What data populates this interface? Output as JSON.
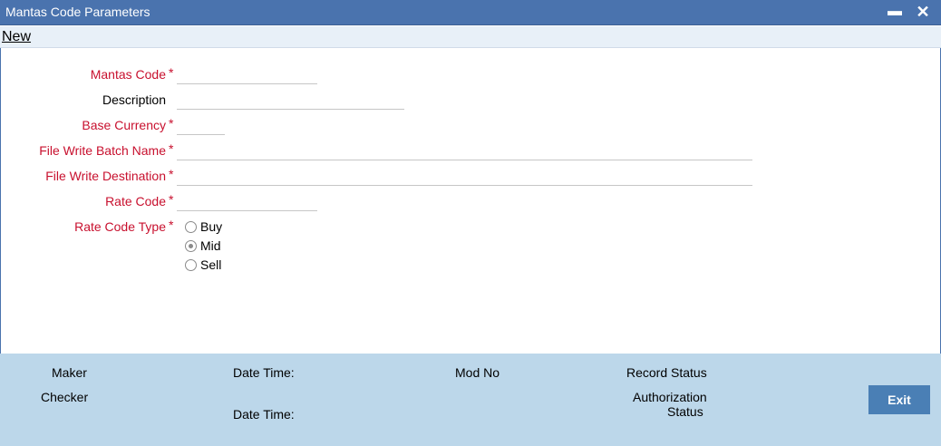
{
  "window": {
    "title": "Mantas Code Parameters",
    "minimize_symbol": "▬",
    "close_symbol": "✕"
  },
  "toolbar": {
    "new_label": "New"
  },
  "form": {
    "mantas_code": {
      "label": "Mantas Code",
      "required": "*",
      "value": ""
    },
    "description": {
      "label": "Description",
      "value": ""
    },
    "base_currency": {
      "label": "Base Currency",
      "required": "*",
      "value": ""
    },
    "file_write_batch_name": {
      "label": "File Write Batch Name",
      "required": "*",
      "value": ""
    },
    "file_write_destination": {
      "label": "File Write Destination",
      "required": "*",
      "value": ""
    },
    "rate_code": {
      "label": "Rate Code",
      "required": "*",
      "value": ""
    },
    "rate_code_type": {
      "label": "Rate Code Type",
      "required": "*",
      "options": [
        "Buy",
        "Mid",
        "Sell"
      ],
      "selected": "Mid"
    }
  },
  "footer": {
    "maker_label": "Maker",
    "checker_label": "Checker",
    "date_time_label_1": "Date Time:",
    "date_time_label_2": "Date Time:",
    "mod_no_label": "Mod No",
    "record_status_label": "Record Status",
    "authorization_label_line1": "Authorization",
    "authorization_label_line2": "Status",
    "exit_label": "Exit"
  },
  "colors": {
    "titlebar": "#4a73ae",
    "required_label": "#c8102e",
    "footer_bg": "#bcd7ea",
    "exit_button": "#4a7fb5"
  }
}
